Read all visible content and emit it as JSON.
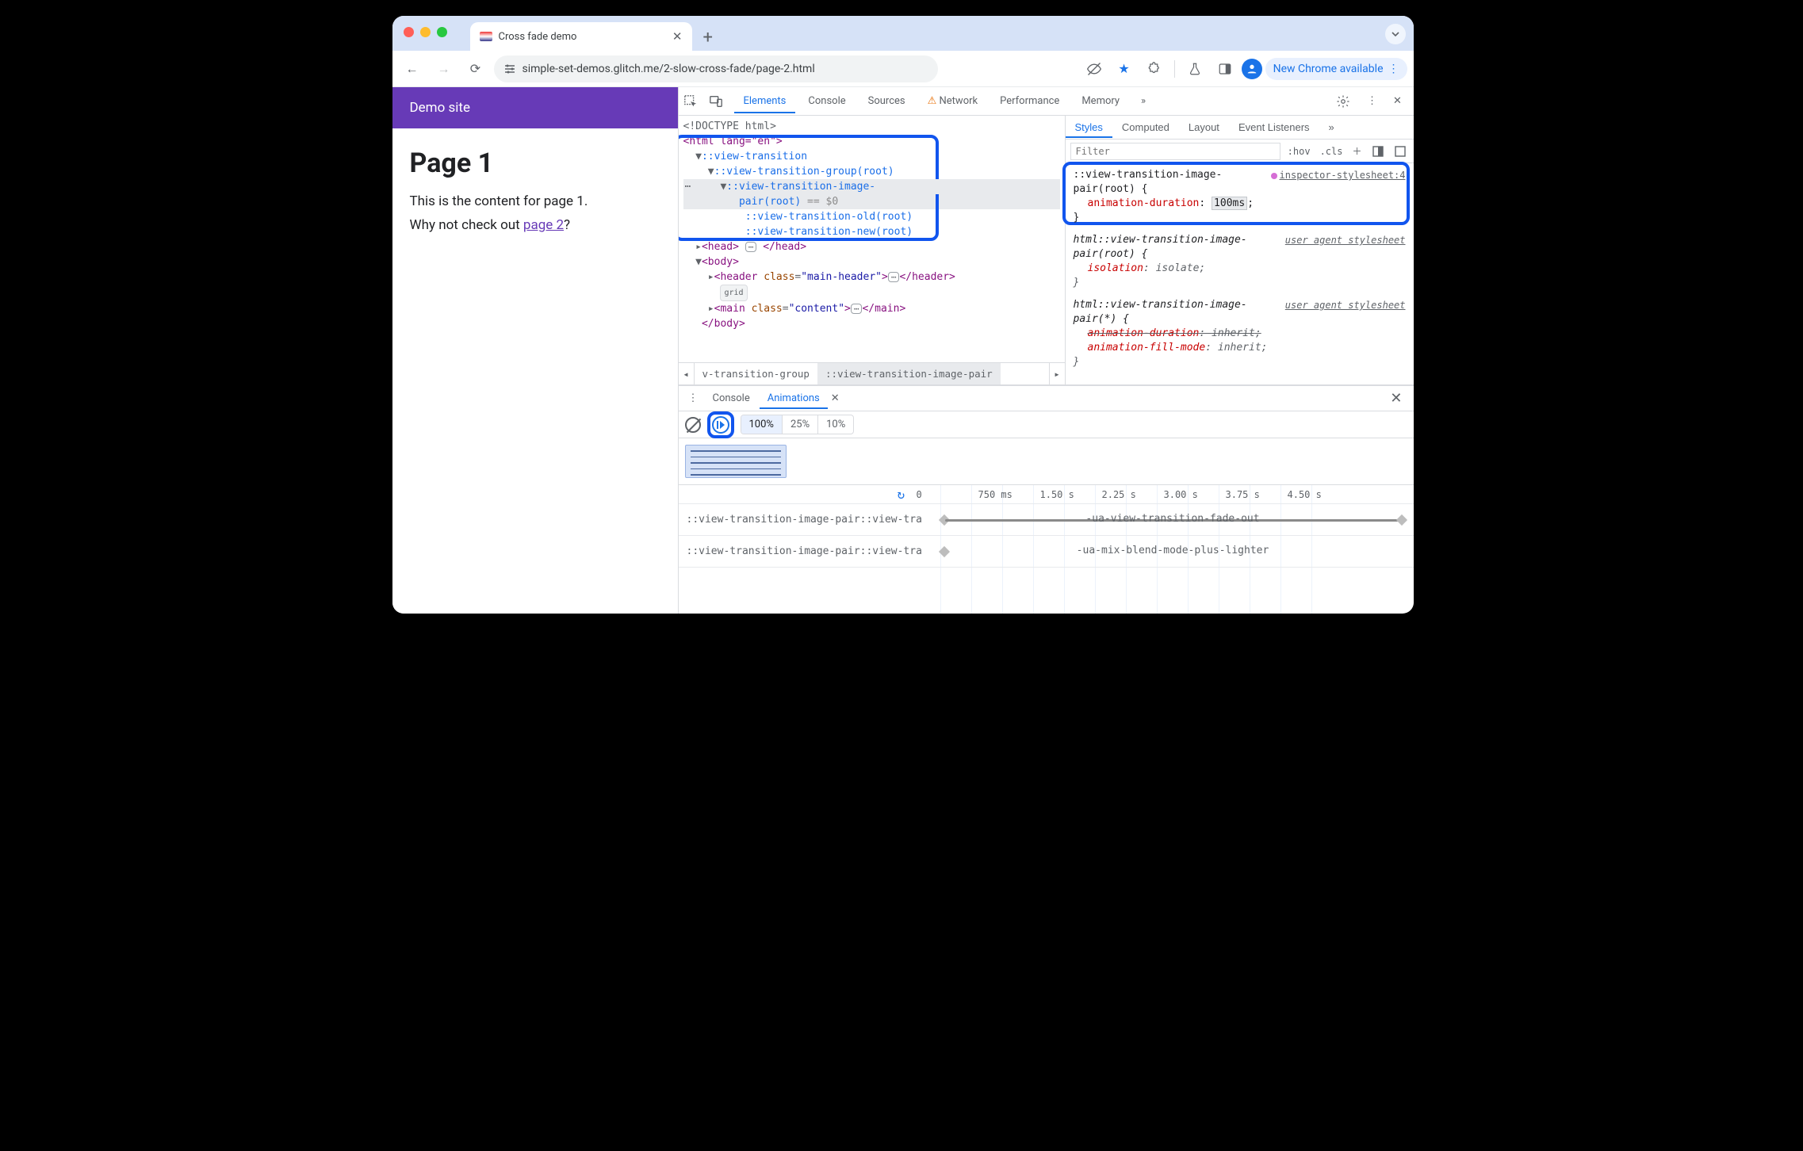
{
  "chrome": {
    "tab_title": "Cross fade demo",
    "url": "simple-set-demos.glitch.me/2-slow-cross-fade/page-2.html",
    "update_pill": "New Chrome available"
  },
  "page": {
    "header": "Demo site",
    "h1": "Page 1",
    "line1": "This is the content for page 1.",
    "line2a": "Why not check out ",
    "link": "page 2",
    "line2b": "?"
  },
  "devtools_tabs": [
    "Elements",
    "Console",
    "Sources",
    "Network",
    "Performance",
    "Memory"
  ],
  "dom": {
    "doctype": "<!DOCTYPE html>",
    "html_open": "<html lang=\"en\">",
    "vt": "::view-transition",
    "vtg": "::view-transition-group(root)",
    "vtip1": "::view-transition-image-",
    "vtip2": "pair(root)",
    "eq": " == ",
    "d0": "$0",
    "vto": "::view-transition-old(root)",
    "vtn": "::view-transition-new(root)",
    "head": "<head>…</head>",
    "body_open": "<body>",
    "header_el": "<header class=\"main-header\">…</header>",
    "grid": "grid",
    "main_el": "<main class=\"content\">…</main>",
    "body_close": "</body>"
  },
  "crumbs": {
    "c1": "v-transition-group",
    "c2": "::view-transition-image-pair"
  },
  "styles_tabs": [
    "Styles",
    "Computed",
    "Layout",
    "Event Listeners"
  ],
  "styles": {
    "filter_ph": "Filter",
    "hov": ":hov",
    "cls": ".cls",
    "r1_sel": "::view-transition-image-pair(root) {",
    "r1_src": "inspector-stylesheet:4",
    "r1_prop": "animation-duration",
    "r1_val": "100ms",
    "r2_sel": "html::view-transition-image-pair(root) {",
    "r2_src": "user agent stylesheet",
    "r2_prop": "isolation",
    "r2_val": "isolate",
    "r3_sel": "html::view-transition-image-pair(*) {",
    "r3_src": "user agent stylesheet",
    "r3_p1": "animation-duration",
    "r3_v1": "inherit",
    "r3_p2": "animation-fill-mode",
    "r3_v2": "inherit",
    "brace": "}"
  },
  "drawer": {
    "tabs": [
      "Console",
      "Animations"
    ],
    "speeds": [
      "100%",
      "25%",
      "10%"
    ],
    "ruler": [
      "0",
      "750 ms",
      "1.50 s",
      "2.25 s",
      "3.00 s",
      "3.75 s",
      "4.50 s"
    ],
    "row1_label": "::view-transition-image-pair::view-tra",
    "row1_anim": "-ua-view-transition-fade-out",
    "row2_label": "::view-transition-image-pair::view-tra",
    "row2_anim": "-ua-mix-blend-mode-plus-lighter"
  }
}
